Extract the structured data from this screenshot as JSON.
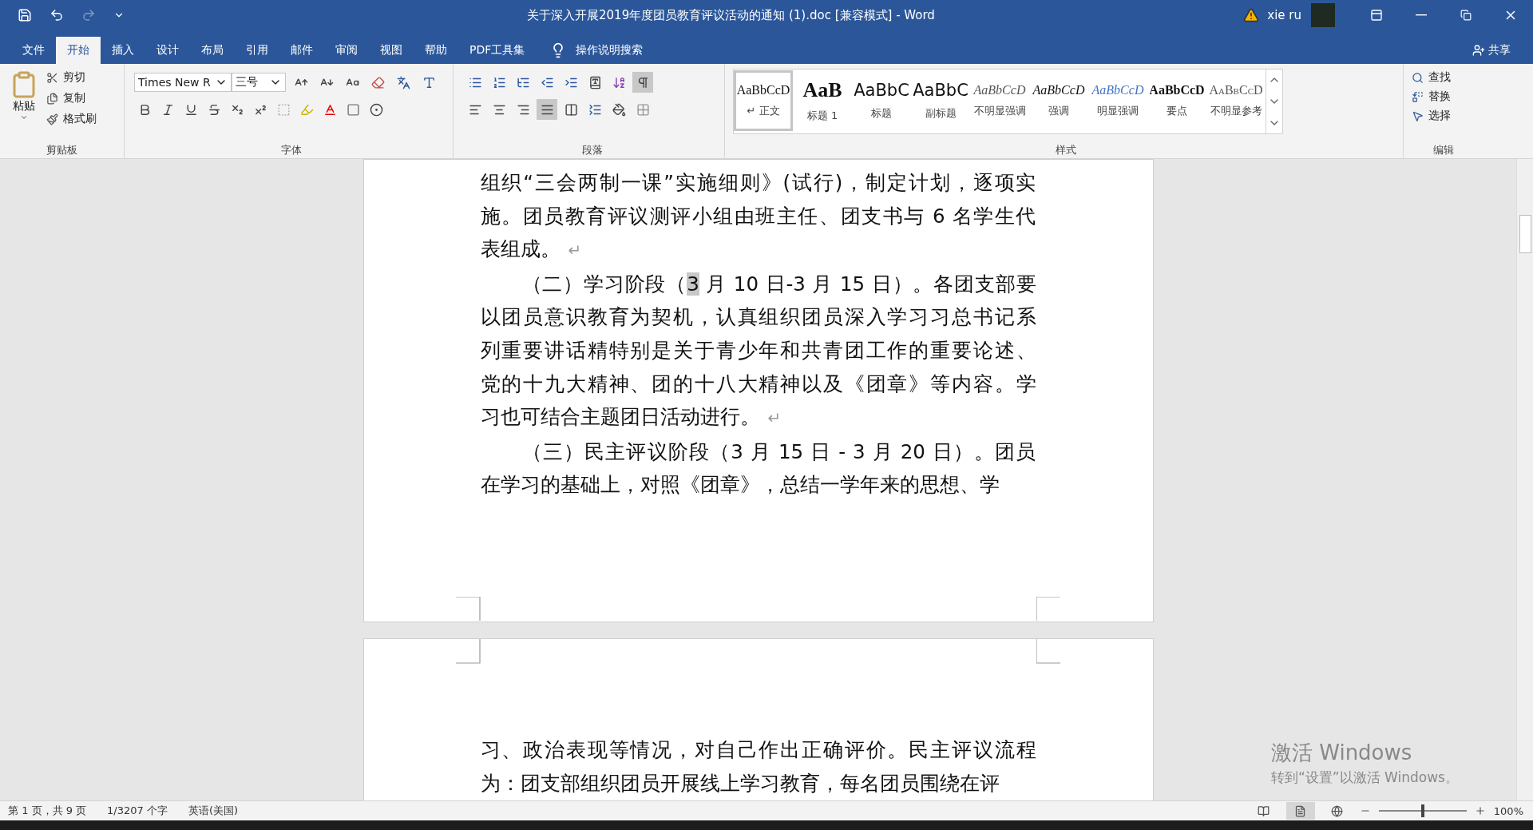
{
  "title_bar": {
    "title": "关于深入开展2019年度团员教育评议活动的通知 (1).doc [兼容模式]  -  Word",
    "user": "xie ru",
    "redo_disabled": true
  },
  "tabs": [
    {
      "label": "文件",
      "selected": false
    },
    {
      "label": "开始",
      "selected": true
    },
    {
      "label": "插入",
      "selected": false
    },
    {
      "label": "设计",
      "selected": false
    },
    {
      "label": "布局",
      "selected": false
    },
    {
      "label": "引用",
      "selected": false
    },
    {
      "label": "邮件",
      "selected": false
    },
    {
      "label": "审阅",
      "selected": false
    },
    {
      "label": "视图",
      "selected": false
    },
    {
      "label": "帮助",
      "selected": false
    },
    {
      "label": "PDF工具集",
      "selected": false
    }
  ],
  "tell_me": "操作说明搜索",
  "share": "共享",
  "clipboard": {
    "paste": "粘贴",
    "actions": [
      {
        "kind": "cut",
        "label": "剪切"
      },
      {
        "kind": "copy",
        "label": "复制"
      },
      {
        "kind": "format_painter",
        "label": "格式刷"
      }
    ],
    "group_label": "剪贴板"
  },
  "font": {
    "name": "Times New R",
    "size": "三号",
    "group_label": "字体"
  },
  "paragraph": {
    "group_label": "段落",
    "show_marks_on": true,
    "alignment": [
      {
        "kind": "left",
        "selected": false
      },
      {
        "kind": "center",
        "selected": false
      },
      {
        "kind": "right",
        "selected": false
      },
      {
        "kind": "justify",
        "selected": true
      },
      {
        "kind": "distributed",
        "selected": false
      }
    ]
  },
  "styles": {
    "group_label": "样式",
    "items": [
      {
        "kind": "normal",
        "preview": "AaBbCcD",
        "label": "↵ 正文",
        "selected": true
      },
      {
        "kind": "heading1",
        "preview": "AaB",
        "label": "标题 1",
        "selected": false
      },
      {
        "kind": "title",
        "preview": "AaBbC",
        "label": "标题",
        "selected": false
      },
      {
        "kind": "subtitle",
        "preview": "AaBbC",
        "label": "副标题",
        "selected": false
      },
      {
        "kind": "subtle_emphasis",
        "preview": "AaBbCcD",
        "label": "不明显强调",
        "selected": false
      },
      {
        "kind": "emphasis",
        "preview": "AaBbCcD",
        "label": "强调",
        "selected": false
      },
      {
        "kind": "intense_emphasis",
        "preview": "AaBbCcD",
        "label": "明显强调",
        "selected": false
      },
      {
        "kind": "strong",
        "preview": "AaBbCcD",
        "label": "要点",
        "selected": false
      },
      {
        "kind": "subtle_reference",
        "preview": "AaBbCcD",
        "label": "不明显参考",
        "selected": false
      }
    ]
  },
  "editing": {
    "group_label": "编辑",
    "actions": [
      {
        "kind": "find",
        "label": "查找"
      },
      {
        "kind": "replace",
        "label": "替换"
      },
      {
        "kind": "select",
        "label": "选择"
      }
    ]
  },
  "pages": [
    {
      "paragraphs": [
        {
          "continued": true,
          "end_mark": "↵",
          "lines": [
            {
              "text": "组织“三会两制一课”实施细则》(试行)，制定计划，逐项实"
            },
            {
              "text": "施。团员教育评议测评小组由班主任、团支书与 6 名学生代"
            },
            {
              "text": "表组成。"
            }
          ]
        },
        {
          "continued": false,
          "end_mark": "↵",
          "lines": [
            {
              "text": "（二）学习阶段（",
              "selected_text": "3",
              "after": " 月 10 日-3 月 15 日）。各团支部要"
            },
            {
              "text": "以团员意识教育为契机，认真组织团员深入学习习总书记系"
            },
            {
              "text": "列重要讲话精特别是关于青少年和共青团工作的重要论述、"
            },
            {
              "text": "党的十九大精神、团的十八大精神以及《团章》等内容。学"
            },
            {
              "text": "习也可结合主题团日活动进行。"
            }
          ]
        },
        {
          "continued": false,
          "lines": [
            {
              "text": "（三）民主评议阶段（3 月 15 日 - 3 月 20 日）。团员"
            },
            {
              "text": "在学习的基础上，对照《团章》，总结一学年来的思想、学"
            }
          ]
        }
      ]
    },
    {
      "paragraphs": [
        {
          "continued": true,
          "lines": [
            {
              "text": "习、政治表现等情况，对自己作出正确评价。民主评议流程"
            },
            {
              "text": "为：团支部组织团员开展线上学习教育，每名团员围绕在评"
            }
          ]
        }
      ]
    }
  ],
  "status_bar": {
    "page": "第 1 页，共 9 页",
    "words": "1/3207 个字",
    "language": "英语(美国)",
    "views": [
      {
        "kind": "read",
        "selected": false
      },
      {
        "kind": "print",
        "selected": true
      },
      {
        "kind": "web",
        "selected": false
      }
    ],
    "zoom": {
      "level": 0.5,
      "reading": "100%"
    }
  },
  "activation_notice": {
    "title": "激活 Windows",
    "hint": "转到“设置”以激活 Windows。"
  }
}
